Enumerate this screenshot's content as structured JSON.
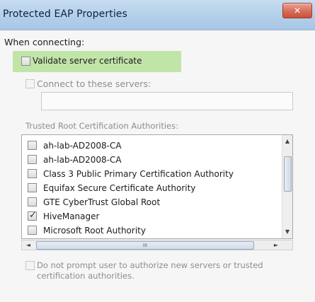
{
  "dialog": {
    "title": "Protected EAP Properties",
    "close_symbol": "✕"
  },
  "when_connecting_label": "When connecting:",
  "validate_cert": {
    "label": "Validate server certificate",
    "checked": false
  },
  "connect_servers": {
    "label": "Connect to these servers:",
    "checked": false,
    "value": ""
  },
  "trusted_label": "Trusted Root Certification Authorities:",
  "authorities": [
    {
      "label": "ah-lab-AD2008-CA",
      "checked": false
    },
    {
      "label": "ah-lab-AD2008-CA",
      "checked": false
    },
    {
      "label": "Class 3 Public Primary Certification Authority",
      "checked": false
    },
    {
      "label": "Equifax Secure Certificate Authority",
      "checked": false
    },
    {
      "label": "GTE CyberTrust Global Root",
      "checked": false
    },
    {
      "label": "HiveManager",
      "checked": true
    },
    {
      "label": "Microsoft Root Authority",
      "checked": false
    }
  ],
  "no_prompt": {
    "label": "Do not prompt user to authorize new servers or trusted certification authorities.",
    "checked": false
  },
  "icons": {
    "scroll_up": "▲",
    "scroll_down": "▼",
    "scroll_left": "◄",
    "scroll_right": "►",
    "thumb_grip_h": "III",
    "check": "✓"
  },
  "colors": {
    "titlebar": "#b3cfe9",
    "highlight": "#b7e29b",
    "close_button": "#d96b56"
  }
}
